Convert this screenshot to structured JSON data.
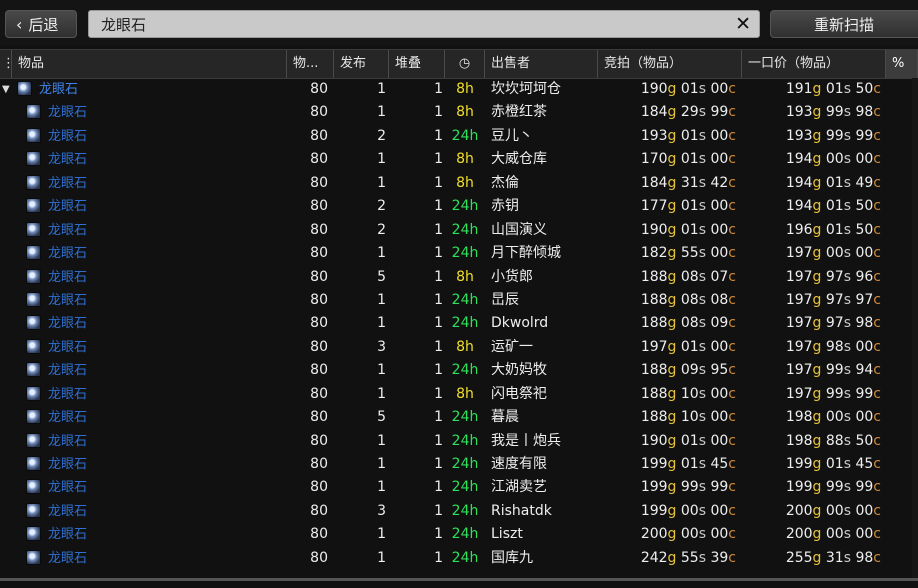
{
  "toolbar": {
    "back_label": "后退",
    "back_icon": "chevron-left-icon",
    "search_value": "龙眼石",
    "clear_icon": "close-icon",
    "rescan_label": "重新扫描"
  },
  "columns": [
    {
      "label": "物品"
    },
    {
      "label": "物..."
    },
    {
      "label": "发布"
    },
    {
      "label": "堆叠"
    },
    {
      "label": "",
      "icon": "clock-icon"
    },
    {
      "label": "出售者"
    },
    {
      "label": "竞拍（物品）"
    },
    {
      "label": "一口价（物品）"
    },
    {
      "label": "%"
    }
  ],
  "colors": {
    "bid_gold": "#e7c33a",
    "time_short": "#f1df2a",
    "time_long": "#2ee05a",
    "item_link": "#2e6fd1"
  },
  "rows": [
    {
      "name": "龙眼石",
      "parent": true,
      "ilvl": "80",
      "posts": "1",
      "stack": "1",
      "time": "8h",
      "seller": "坎坎坷坷仓",
      "bid": [
        "190",
        "01",
        "00"
      ],
      "buy": [
        "191",
        "01",
        "50"
      ]
    },
    {
      "name": "龙眼石",
      "ilvl": "80",
      "posts": "1",
      "stack": "1",
      "time": "8h",
      "seller": "赤橙红茶",
      "bid": [
        "184",
        "29",
        "99"
      ],
      "buy": [
        "193",
        "99",
        "98"
      ]
    },
    {
      "name": "龙眼石",
      "ilvl": "80",
      "posts": "2",
      "stack": "1",
      "time": "24h",
      "seller": "豆儿丶",
      "bid": [
        "193",
        "01",
        "00"
      ],
      "buy": [
        "193",
        "99",
        "99"
      ]
    },
    {
      "name": "龙眼石",
      "ilvl": "80",
      "posts": "1",
      "stack": "1",
      "time": "8h",
      "seller": "大威仓库",
      "bid": [
        "170",
        "01",
        "00"
      ],
      "buy": [
        "194",
        "00",
        "00"
      ]
    },
    {
      "name": "龙眼石",
      "ilvl": "80",
      "posts": "1",
      "stack": "1",
      "time": "8h",
      "seller": "杰倫",
      "bid": [
        "184",
        "31",
        "42"
      ],
      "buy": [
        "194",
        "01",
        "49"
      ]
    },
    {
      "name": "龙眼石",
      "ilvl": "80",
      "posts": "2",
      "stack": "1",
      "time": "24h",
      "seller": "赤钥",
      "bid": [
        "177",
        "01",
        "00"
      ],
      "buy": [
        "194",
        "01",
        "50"
      ]
    },
    {
      "name": "龙眼石",
      "ilvl": "80",
      "posts": "2",
      "stack": "1",
      "time": "24h",
      "seller": "山国演义",
      "bid": [
        "190",
        "01",
        "00"
      ],
      "buy": [
        "196",
        "01",
        "50"
      ]
    },
    {
      "name": "龙眼石",
      "ilvl": "80",
      "posts": "1",
      "stack": "1",
      "time": "24h",
      "seller": "月下醉倾城",
      "bid": [
        "182",
        "55",
        "00"
      ],
      "buy": [
        "197",
        "00",
        "00"
      ]
    },
    {
      "name": "龙眼石",
      "ilvl": "80",
      "posts": "5",
      "stack": "1",
      "time": "8h",
      "seller": "小货郎",
      "bid": [
        "188",
        "08",
        "07"
      ],
      "buy": [
        "197",
        "97",
        "96"
      ]
    },
    {
      "name": "龙眼石",
      "ilvl": "80",
      "posts": "1",
      "stack": "1",
      "time": "24h",
      "seller": "旵辰",
      "bid": [
        "188",
        "08",
        "08"
      ],
      "buy": [
        "197",
        "97",
        "97"
      ]
    },
    {
      "name": "龙眼石",
      "ilvl": "80",
      "posts": "1",
      "stack": "1",
      "time": "24h",
      "seller": "Dkwolrd",
      "bid": [
        "188",
        "08",
        "09"
      ],
      "buy": [
        "197",
        "97",
        "98"
      ]
    },
    {
      "name": "龙眼石",
      "ilvl": "80",
      "posts": "3",
      "stack": "1",
      "time": "8h",
      "seller": "运矿一",
      "bid": [
        "197",
        "01",
        "00"
      ],
      "buy": [
        "197",
        "98",
        "00"
      ]
    },
    {
      "name": "龙眼石",
      "ilvl": "80",
      "posts": "1",
      "stack": "1",
      "time": "24h",
      "seller": "大奶妈牧",
      "bid": [
        "188",
        "09",
        "95"
      ],
      "buy": [
        "197",
        "99",
        "94"
      ]
    },
    {
      "name": "龙眼石",
      "ilvl": "80",
      "posts": "1",
      "stack": "1",
      "time": "8h",
      "seller": "闪电祭祀",
      "bid": [
        "188",
        "10",
        "00"
      ],
      "buy": [
        "197",
        "99",
        "99"
      ]
    },
    {
      "name": "龙眼石",
      "ilvl": "80",
      "posts": "5",
      "stack": "1",
      "time": "24h",
      "seller": "暮晨",
      "bid": [
        "188",
        "10",
        "00"
      ],
      "buy": [
        "198",
        "00",
        "00"
      ]
    },
    {
      "name": "龙眼石",
      "ilvl": "80",
      "posts": "1",
      "stack": "1",
      "time": "24h",
      "seller": "我是丨炮兵",
      "bid": [
        "190",
        "01",
        "00"
      ],
      "buy": [
        "198",
        "88",
        "50"
      ]
    },
    {
      "name": "龙眼石",
      "ilvl": "80",
      "posts": "1",
      "stack": "1",
      "time": "24h",
      "seller": "速度有限",
      "bid": [
        "199",
        "01",
        "45"
      ],
      "buy": [
        "199",
        "01",
        "45"
      ]
    },
    {
      "name": "龙眼石",
      "ilvl": "80",
      "posts": "1",
      "stack": "1",
      "time": "24h",
      "seller": "江湖卖艺",
      "bid": [
        "199",
        "99",
        "99"
      ],
      "buy": [
        "199",
        "99",
        "99"
      ]
    },
    {
      "name": "龙眼石",
      "ilvl": "80",
      "posts": "3",
      "stack": "1",
      "time": "24h",
      "seller": "Rishatdk",
      "bid": [
        "199",
        "00",
        "00"
      ],
      "buy": [
        "200",
        "00",
        "00"
      ]
    },
    {
      "name": "龙眼石",
      "ilvl": "80",
      "posts": "1",
      "stack": "1",
      "time": "24h",
      "seller": "Liszt",
      "bid": [
        "200",
        "00",
        "00"
      ],
      "buy": [
        "200",
        "00",
        "00"
      ]
    },
    {
      "name": "龙眼石",
      "ilvl": "80",
      "posts": "1",
      "stack": "1",
      "time": "24h",
      "seller": "国库九",
      "bid": [
        "242",
        "55",
        "39"
      ],
      "buy": [
        "255",
        "31",
        "98"
      ]
    }
  ]
}
